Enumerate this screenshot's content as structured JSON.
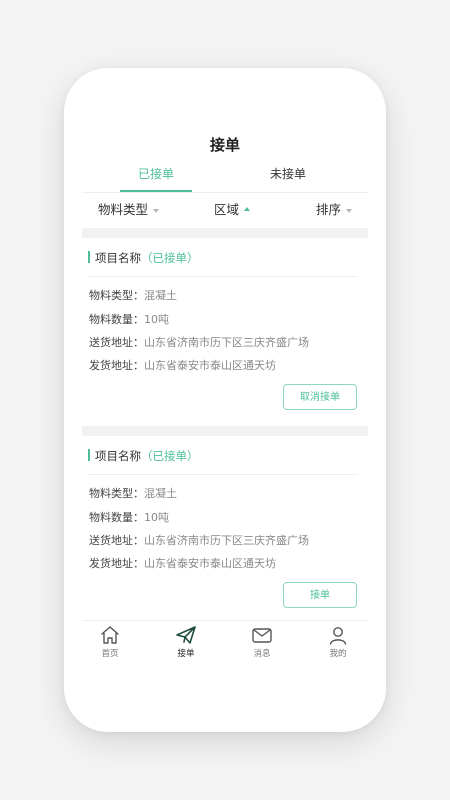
{
  "header": {
    "title": "接单"
  },
  "tabs": [
    {
      "label": "已接单",
      "active": true
    },
    {
      "label": "未接单",
      "active": false
    }
  ],
  "filters": [
    {
      "label": "物料类型",
      "caret": "down"
    },
    {
      "label": "区域",
      "caret": "up"
    },
    {
      "label": "排序",
      "caret": "down"
    }
  ],
  "cards": [
    {
      "title": "项目名称",
      "state": "（已接单）",
      "fields": [
        {
          "key": "物料类型：",
          "value": "混凝土"
        },
        {
          "key": "物料数量：",
          "value": "10吨"
        },
        {
          "key": "送货地址：",
          "value": "山东省济南市历下区三庆齐盛广场"
        },
        {
          "key": "发货地址：",
          "value": "山东省泰安市泰山区通天坊"
        }
      ],
      "button": "取消接单"
    },
    {
      "title": "项目名称",
      "state": "（已接单）",
      "fields": [
        {
          "key": "物料类型：",
          "value": "混凝土"
        },
        {
          "key": "物料数量：",
          "value": "10吨"
        },
        {
          "key": "送货地址：",
          "value": "山东省济南市历下区三庆齐盛广场"
        },
        {
          "key": "发货地址：",
          "value": "山东省泰安市泰山区通天坊"
        }
      ],
      "button": "接单"
    }
  ],
  "nav": [
    {
      "label": "首页",
      "icon": "home-icon",
      "active": false
    },
    {
      "label": "接单",
      "icon": "paper-plane-icon",
      "active": true
    },
    {
      "label": "消息",
      "icon": "mail-icon",
      "active": false
    },
    {
      "label": "我的",
      "icon": "user-icon",
      "active": false
    }
  ],
  "colors": {
    "accent": "#4dbf9c",
    "text": "#333333",
    "muted": "#888888"
  }
}
